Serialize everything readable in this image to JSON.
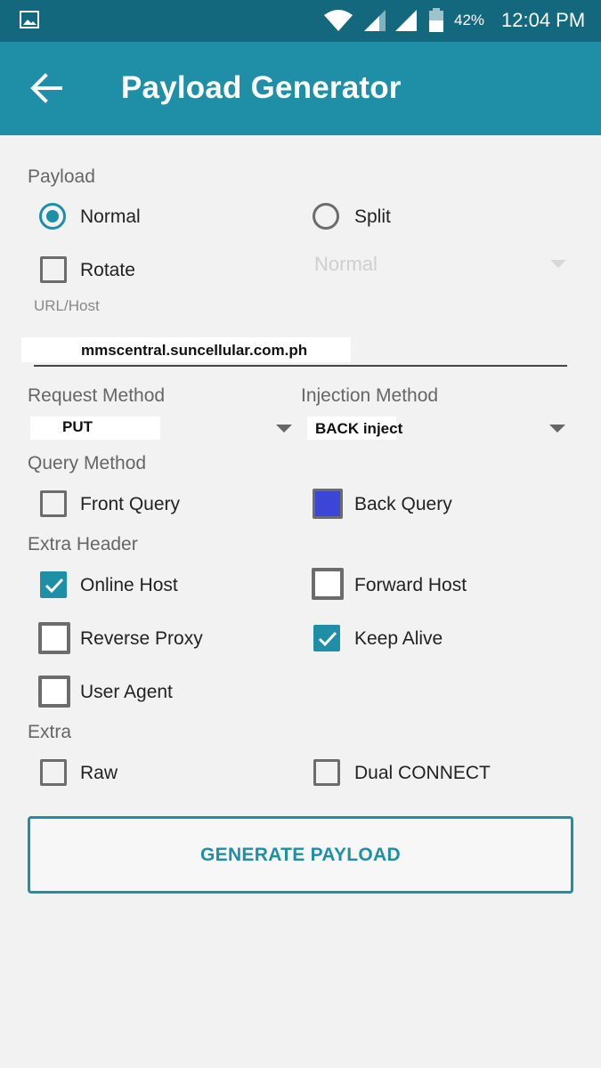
{
  "status_bar": {
    "battery": "42%",
    "time": "12:04 PM"
  },
  "app_bar": {
    "title": "Payload Generator"
  },
  "payload": {
    "label": "Payload",
    "normal_label": "Normal",
    "split_label": "Split",
    "rotate_label": "Rotate",
    "split_select_value": "Normal"
  },
  "url_host": {
    "label": "URL/Host",
    "value": "mmscentral.suncellular.com.ph"
  },
  "request_method": {
    "label": "Request Method",
    "value": "PUT"
  },
  "injection_method": {
    "label": "Injection Method",
    "value": "BACK inject"
  },
  "query_method": {
    "label": "Query Method",
    "front_label": "Front Query",
    "back_label": "Back Query"
  },
  "extra_header": {
    "label": "Extra Header",
    "online_host": "Online Host",
    "forward_host": "Forward Host",
    "reverse_proxy": "Reverse Proxy",
    "keep_alive": "Keep Alive",
    "user_agent": "User Agent"
  },
  "extra": {
    "label": "Extra",
    "raw": "Raw",
    "dual_connect": "Dual CONNECT"
  },
  "generate_button": "GENERATE PAYLOAD",
  "colors": {
    "status_bar": "#13687d",
    "app_bar": "#1e8fa6",
    "accent": "#1e8fa6",
    "back_query_fill": "#3b46d6"
  }
}
